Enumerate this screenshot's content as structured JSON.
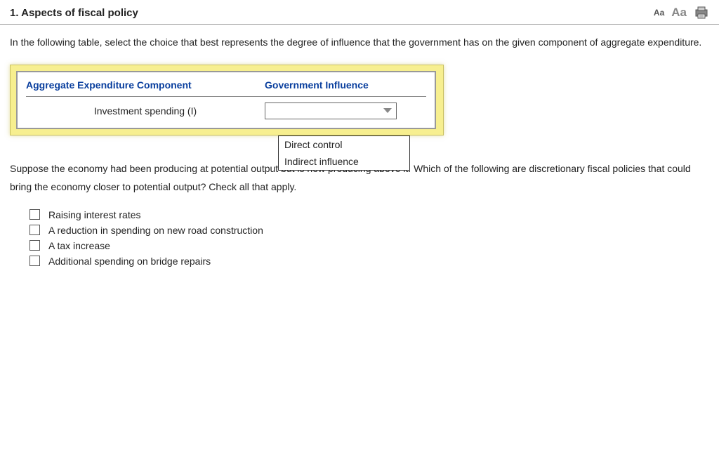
{
  "header": {
    "title": "1.  Aspects of fiscal policy",
    "font_small": "Aa",
    "font_large": "Aa"
  },
  "intro": "In the following table, select the choice that best represents the degree of influence that the government has on the given component of aggregate expenditure.",
  "table": {
    "header_col1": "Aggregate Expenditure Component",
    "header_col2": "Government Influence",
    "row_label": "Investment spending (I)",
    "dropdown_options": [
      "Direct control",
      "Indirect influence"
    ]
  },
  "question2": "Suppose the economy had been producing at potential output but is now producing above it. Which of the following are discretionary fiscal policies that could bring the economy closer to potential output? Check all that apply.",
  "checkboxes": [
    "Raising interest rates",
    "A reduction in spending on new road construction",
    "A tax increase",
    "Additional spending on bridge repairs"
  ]
}
